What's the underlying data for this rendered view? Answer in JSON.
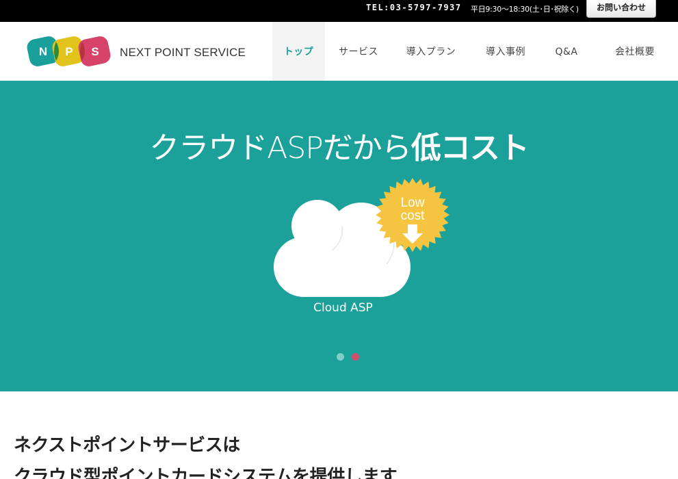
{
  "topbar": {
    "tel": "TEL:03-5797-7937",
    "hours": "平日9:30〜18:30(土･日･祝除く)",
    "contact_label": "お問い合わせ"
  },
  "header": {
    "logo_letters": [
      "N",
      "P",
      "S"
    ],
    "logo_colors": [
      "#1aa09a",
      "#e2c31c",
      "#d6426a"
    ],
    "brand": "NEXT POINT SERVICE",
    "nav": [
      {
        "label": "トップ",
        "active": true
      },
      {
        "label": "サービス",
        "active": false
      },
      {
        "label": "導入プラン",
        "active": false
      },
      {
        "label": "導入事例",
        "active": false
      },
      {
        "label": "Q&A",
        "active": false
      },
      {
        "label": "会社概要",
        "active": false
      }
    ]
  },
  "hero": {
    "title_light": "クラウドASPだから",
    "title_bold": "低コスト",
    "badge_line1": "Low",
    "badge_line2": "cost",
    "cloud_label": "Cloud ASP",
    "bg_color": "#1ba19a",
    "badge_color": "#f5c542",
    "slide_count": 2,
    "active_slide": 2
  },
  "intro": {
    "line1": "ネクストポイントサービスは",
    "line2": "クラウド型ポイントカードシステムを提供します"
  }
}
